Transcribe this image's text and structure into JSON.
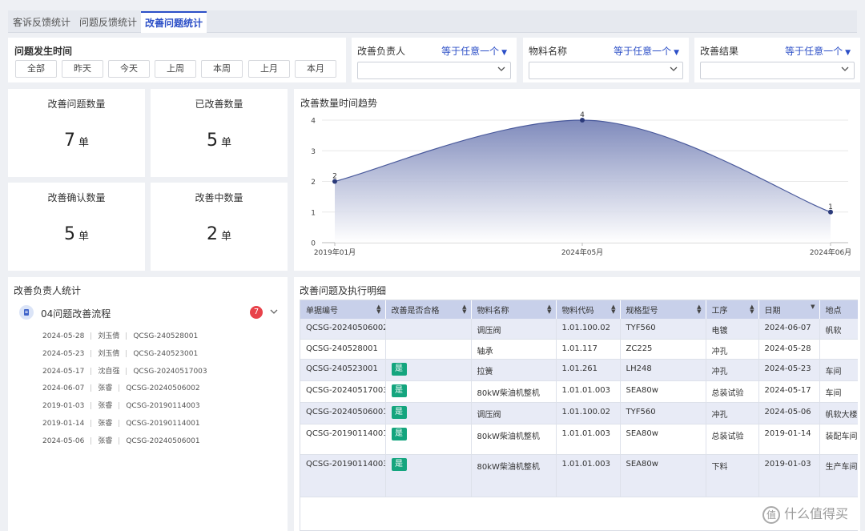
{
  "tabs": [
    {
      "label": "客诉反馈统计"
    },
    {
      "label": "问题反馈统计"
    },
    {
      "label": "改善问题统计"
    }
  ],
  "time_filter": {
    "title": "问题发生时间",
    "buttons": [
      "全部",
      "昨天",
      "今天",
      "上周",
      "本周",
      "上月",
      "本月"
    ]
  },
  "filters": [
    {
      "label": "改善负责人",
      "operator": "等于任意一个"
    },
    {
      "label": "物料名称",
      "operator": "等于任意一个"
    },
    {
      "label": "改善结果",
      "operator": "等于任意一个"
    }
  ],
  "kpis": [
    {
      "title": "改善问题数量",
      "value": "7",
      "unit": "单"
    },
    {
      "title": "已改善数量",
      "value": "5",
      "unit": "单"
    },
    {
      "title": "改善确认数量",
      "value": "5",
      "unit": "单"
    },
    {
      "title": "改善中数量",
      "value": "2",
      "unit": "单"
    }
  ],
  "chart_data": {
    "type": "area",
    "title": "改善数量时间趋势",
    "categories": [
      "2019年01月",
      "2024年05月",
      "2024年06月"
    ],
    "series": [
      {
        "values": [
          2,
          4,
          1
        ]
      }
    ],
    "ylim": [
      0,
      4
    ],
    "yticks": [
      "0",
      "1",
      "2",
      "3",
      "4"
    ],
    "grid": true,
    "colors": {
      "line": "#4a5a9c",
      "fill_top": "#7884b8",
      "fill_bottom": "#ffffff",
      "point": "#2b3a7a"
    }
  },
  "owner_stats": {
    "title": "改善负责人统计",
    "flow_name": "04问题改善流程",
    "count": "7",
    "items": [
      {
        "date": "2024-05-28",
        "person": "刘玉倩",
        "code": "QCSG-240528001"
      },
      {
        "date": "2024-05-23",
        "person": "刘玉倩",
        "code": "QCSG-240523001"
      },
      {
        "date": "2024-05-17",
        "person": "沈自强",
        "code": "QCSG-20240517003"
      },
      {
        "date": "2024-06-07",
        "person": "张睿",
        "code": "QCSG-20240506002"
      },
      {
        "date": "2019-01-03",
        "person": "张睿",
        "code": "QCSG-20190114003"
      },
      {
        "date": "2019-01-14",
        "person": "张睿",
        "code": "QCSG-20190114001"
      },
      {
        "date": "2024-05-06",
        "person": "张睿",
        "code": "QCSG-20240506001"
      }
    ]
  },
  "detail_table": {
    "title": "改善问题及执行明细",
    "columns": [
      "单据编号",
      "改善是否合格",
      "物料名称",
      "物料代码",
      "规格型号",
      "工序",
      "日期",
      "地点"
    ],
    "rows": [
      [
        "QCSG-20240506002",
        "",
        "调压阀",
        "1.01.100.02",
        "TYF560",
        "电镀",
        "2024-06-07",
        "帆软"
      ],
      [
        "QCSG-240528001",
        "",
        "轴承",
        "1.01.117",
        "ZC225",
        "冲孔",
        "2024-05-28",
        ""
      ],
      [
        "QCSG-240523001",
        "是",
        "拉簧",
        "1.01.261",
        "LH248",
        "冲孔",
        "2024-05-23",
        "车间"
      ],
      [
        "QCSG-20240517003",
        "是",
        "80kW柴油机整机",
        "1.01.01.003",
        "SEA80w",
        "总装试验",
        "2024-05-17",
        "车间"
      ],
      [
        "QCSG-20240506001",
        "是",
        "调压阀",
        "1.01.100.02",
        "TYF560",
        "冲孔",
        "2024-05-06",
        "帆软大楼"
      ],
      [
        "QCSG-20190114001",
        "是",
        "80kW柴油机整机",
        "1.01.01.003",
        "SEA80w",
        "总装试验",
        "2019-01-14",
        "装配车间"
      ],
      [
        "QCSG-20190114003",
        "是",
        "80kW柴油机整机",
        "1.01.01.003",
        "SEA80w",
        "下料",
        "2019-01-03",
        "生产车间"
      ]
    ]
  },
  "watermark": "什么值得买"
}
